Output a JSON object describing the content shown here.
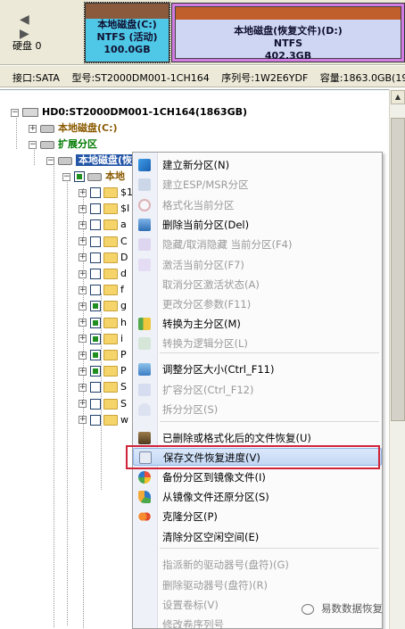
{
  "disk_bar": {
    "nav": {
      "back": "◀",
      "forward": "▶"
    },
    "disk_label": "硬盘 0",
    "partitions": [
      {
        "name": "本地磁盘(C:)",
        "fs": "NTFS (活动)",
        "size": "100.0GB"
      },
      {
        "name": "本地磁盘(恢复文件)(D:)",
        "fs": "NTFS",
        "size": "402.3GB"
      }
    ]
  },
  "info_bar": {
    "interface": "接口:SATA",
    "model": "型号:ST2000DM001-1CH164",
    "serial": "序列号:1W2E6YDF",
    "capacity": "容量:1863.0GB(190772"
  },
  "tree": {
    "disk": "HD0:ST2000DM001-1CH164(1863GB)",
    "c_drive": "本地磁盘(C:)",
    "extended": "扩展分区",
    "d_drive": "本地磁盘(恢复文件)(D:)",
    "d_sub": "本地",
    "items": [
      {
        "label": "$1",
        "indent": 1
      },
      {
        "label": "$I",
        "indent": 1
      },
      {
        "label": "a",
        "indent": 1
      },
      {
        "label": "C",
        "indent": 1
      },
      {
        "label": "D",
        "indent": 1
      },
      {
        "label": "d",
        "indent": 1
      },
      {
        "label": "f",
        "indent": 1
      },
      {
        "label": "g",
        "indent": 1
      },
      {
        "label": "h",
        "indent": 1
      },
      {
        "label": "i",
        "indent": 1
      },
      {
        "label": "P",
        "indent": 1
      },
      {
        "label": "P",
        "indent": 1
      },
      {
        "label": "S",
        "indent": 1
      },
      {
        "label": "S",
        "indent": 1
      },
      {
        "label": "w",
        "indent": 1
      }
    ]
  },
  "context_menu": {
    "items": [
      {
        "label": "建立新分区(N)",
        "enabled": true,
        "icon": "new-partition-icon"
      },
      {
        "label": "建立ESP/MSR分区",
        "enabled": false,
        "icon": "esp-icon"
      },
      {
        "label": "格式化当前分区",
        "enabled": false,
        "icon": "format-icon"
      },
      {
        "label": "删除当前分区(Del)",
        "enabled": true,
        "icon": "trash-icon"
      },
      {
        "label": "隐藏/取消隐藏 当前分区(F4)",
        "enabled": false,
        "icon": "hide-icon"
      },
      {
        "label": "激活当前分区(F7)",
        "enabled": false,
        "icon": "activate-icon"
      },
      {
        "label": "取消分区激活状态(A)",
        "enabled": false,
        "icon": ""
      },
      {
        "label": "更改分区参数(F11)",
        "enabled": false,
        "icon": ""
      },
      {
        "label": "转换为主分区(M)",
        "enabled": true,
        "icon": "primary-icon"
      },
      {
        "label": "转换为逻辑分区(L)",
        "enabled": false,
        "icon": "logical-icon"
      },
      {
        "label": "调整分区大小(Ctrl_F11)",
        "enabled": true,
        "icon": "resize-icon"
      },
      {
        "label": "扩容分区(Ctrl_F12)",
        "enabled": false,
        "icon": "extend-icon"
      },
      {
        "label": "拆分分区(S)",
        "enabled": false,
        "icon": "split-icon"
      },
      {
        "label": "已删除或格式化后的文件恢复(U)",
        "enabled": true,
        "icon": "recover-icon"
      },
      {
        "label": "保存文件恢复进度(V)",
        "enabled": true,
        "icon": "save-progress-icon"
      },
      {
        "label": "备份分区到镜像文件(I)",
        "enabled": true,
        "icon": "backup-image-icon"
      },
      {
        "label": "从镜像文件还原分区(S)",
        "enabled": true,
        "icon": "restore-image-icon"
      },
      {
        "label": "克隆分区(P)",
        "enabled": true,
        "icon": "clone-icon"
      },
      {
        "label": "清除分区空闲空间(E)",
        "enabled": true,
        "icon": ""
      },
      {
        "label": "指派新的驱动器号(盘符)(G)",
        "enabled": false,
        "icon": ""
      },
      {
        "label": "删除驱动器号(盘符)(R)",
        "enabled": false,
        "icon": ""
      },
      {
        "label": "设置卷标(V)",
        "enabled": false,
        "icon": ""
      },
      {
        "label": "修改卷序列号",
        "enabled": false,
        "icon": ""
      }
    ]
  },
  "watermark": "易数数据恢复"
}
